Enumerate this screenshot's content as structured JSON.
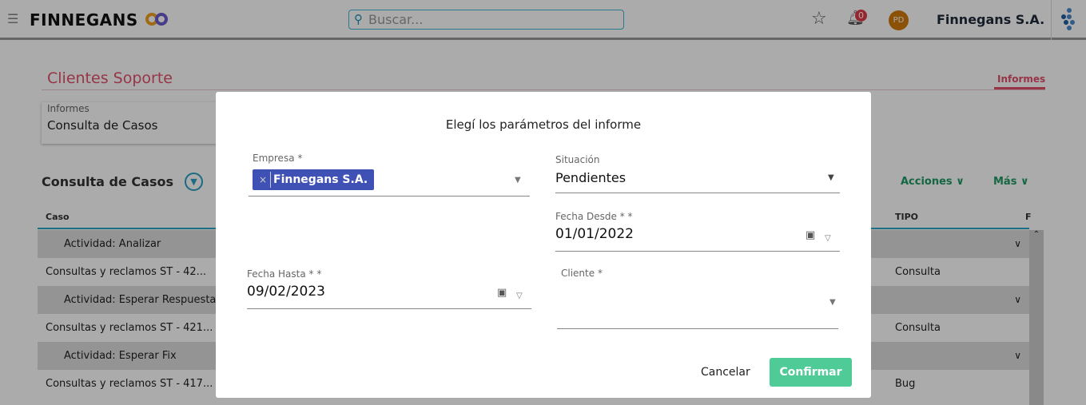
{
  "header": {
    "brand": "FINNEGANS",
    "search_placeholder": "Buscar...",
    "notifications": "0",
    "avatar": "PD",
    "company": "Finnegans S.A."
  },
  "page": {
    "title": "Clientes Soporte",
    "tab": "Informes",
    "card_label": "Informes",
    "card_value": "Consulta de Casos",
    "section": "Consulta de Casos",
    "acciones": "Acciones",
    "mas": "Más"
  },
  "table": {
    "columns": [
      "Caso",
      "TIPO",
      "F"
    ],
    "rows": [
      {
        "group": true,
        "text": "Actividad: Analizar"
      },
      {
        "group": false,
        "text": "Consultas y reclamos ST - 42...",
        "tipo": "Consulta"
      },
      {
        "group": true,
        "text": "Actividad: Esperar Respuesta"
      },
      {
        "group": false,
        "text": "Consultas y reclamos ST - 421...",
        "tipo": "Consulta"
      },
      {
        "group": true,
        "text": "Actividad: Esperar Fix"
      },
      {
        "group": false,
        "text": "Consultas y reclamos ST - 417...",
        "tipo": "Bug"
      }
    ]
  },
  "modal": {
    "title": "Elegí los parámetros del informe",
    "empresa_label": "Empresa *",
    "empresa_chip": "Finnegans S.A.",
    "situacion_label": "Situación",
    "situacion_value": "Pendientes",
    "desde_label": "Fecha Desde * *",
    "desde_value": "01/01/2022",
    "hasta_label": "Fecha Hasta * *",
    "hasta_value": "09/02/2023",
    "cliente_label": "Cliente *",
    "cancel": "Cancelar",
    "confirm": "Confirmar"
  },
  "colors": {
    "accent": "#e2506a",
    "chip": "#3f51b5",
    "confirm": "#4ecb97"
  }
}
